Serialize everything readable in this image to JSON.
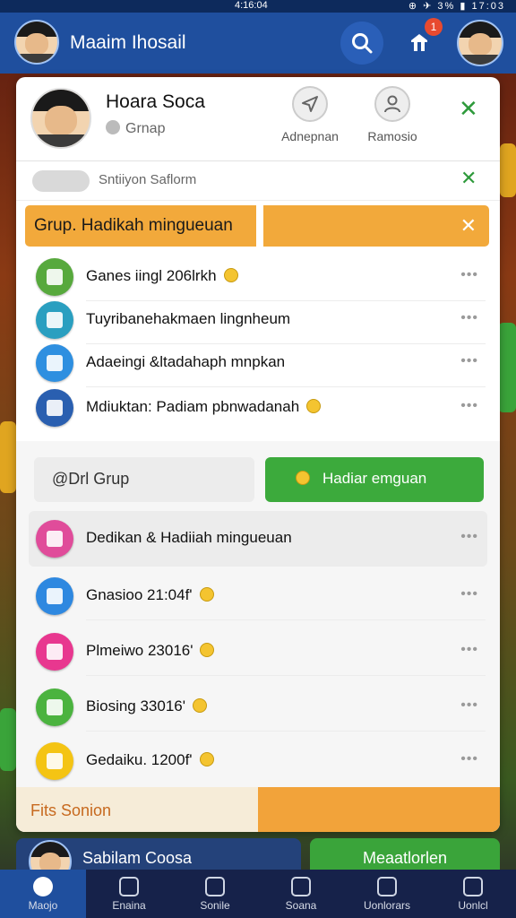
{
  "status_bar": {
    "time": "4:16:04",
    "right": "⊕ ✈ 3% ▮ 17:03"
  },
  "top_bar": {
    "title": "Maaim Ihosail",
    "notification_count": "1"
  },
  "panel": {
    "profile_name": "Hoara Soca",
    "profile_sub": "Grnap",
    "action_1_label": "Adnepnan",
    "action_2_label": "Ramosio",
    "filter_text": "Sntiiyon Saflorm",
    "banner_text": "Grup. Hadikah mingueuan",
    "list_top": [
      {
        "text": "Ganes iingl 206lrkh",
        "color": "#57a93d"
      },
      {
        "text": "Tuyribanehakmaen lingnheum",
        "color": "#2a9fc0"
      },
      {
        "text": "Adaeingi &ltadahaph mnpkan",
        "color": "#2e8fe0"
      },
      {
        "text": "Mdiuktan: Padiam pbnwadanah",
        "color": "#2a5fb0"
      }
    ],
    "button_group_label": "@Drl Grup",
    "button_reward_label": "Hadiar emguan",
    "highlight_row": {
      "text": "Dedikan & Hadiiah mingueuan",
      "color": "#e04c9a"
    },
    "list_bottom": [
      {
        "text": "Gnasioo 21:04f'",
        "color": "#2e88e0"
      },
      {
        "text": "Plmeiwo 23016'",
        "color": "#e8378f"
      },
      {
        "text": "Biosing 33016'",
        "color": "#4bb33f"
      },
      {
        "text": "Gedaiku. 1200f'",
        "color": "#f4c414"
      }
    ],
    "footer_label": "Fits Sonion"
  },
  "bottom_cards": {
    "left_label": "Sabilam Coosa",
    "right_label": "Meaatlorlen"
  },
  "nav": {
    "tabs": [
      "Maojo",
      "Enaina",
      "Sonile",
      "Soana",
      "Uonlorars",
      "Uonlcl"
    ]
  },
  "icons": {
    "search": "search-icon",
    "bell": "bell-icon",
    "send": "send-icon",
    "user": "user-icon",
    "close": "close-icon",
    "more": "more-icon",
    "coin": "coin-icon"
  }
}
